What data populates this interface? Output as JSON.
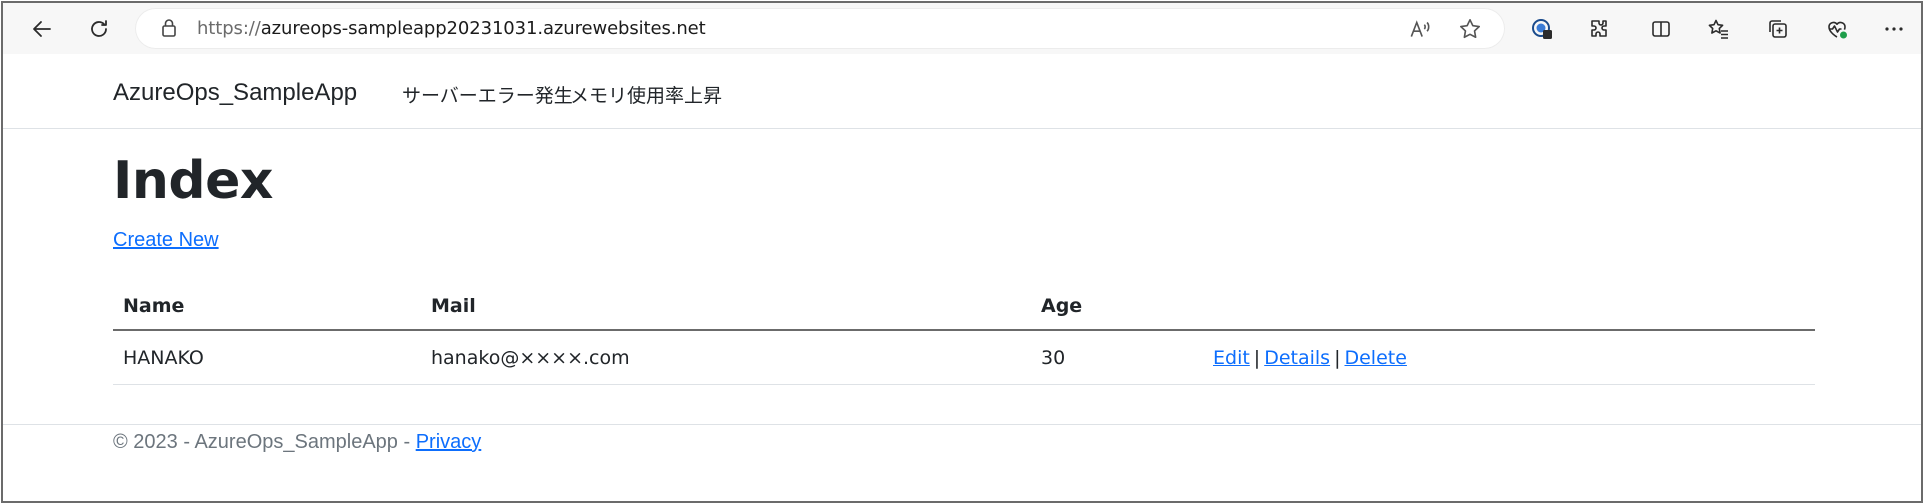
{
  "browser": {
    "url_protocol": "https://",
    "url_host": "azureops-sampleapp20231031.azurewebsites.net"
  },
  "navbar": {
    "brand": "AzureOps_SampleApp",
    "links": [
      "サーバーエラー発生",
      "メモリ使用率上昇"
    ]
  },
  "page": {
    "title": "Index",
    "create_new": "Create New"
  },
  "table": {
    "columns": [
      "Name",
      "Mail",
      "Age"
    ],
    "rows": [
      {
        "name": "HANAKO",
        "mail": "hanako@××××.com",
        "age": "30",
        "actions": {
          "edit": "Edit",
          "details": "Details",
          "delete": "Delete",
          "separator": "|"
        }
      }
    ]
  },
  "footer": {
    "text": "© 2023 - AzureOps_SampleApp - ",
    "privacy": "Privacy"
  },
  "colors": {
    "link": "#0d6efd",
    "text": "#212529",
    "muted": "#6c757d"
  }
}
